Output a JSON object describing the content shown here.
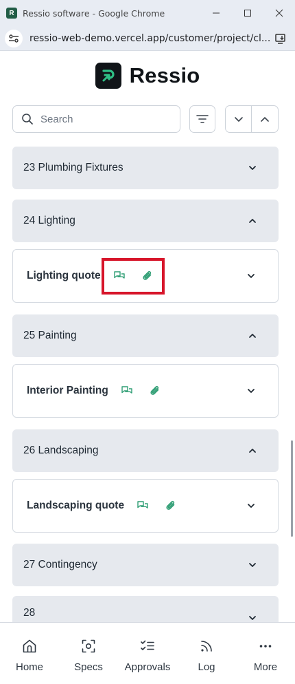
{
  "browser": {
    "window_title": "Ressio software - Google Chrome",
    "url": "ressio-web-demo.vercel.app/customer/project/cl..."
  },
  "app": {
    "brand_name": "Ressio"
  },
  "toolbar": {
    "search_placeholder": "Search"
  },
  "sections": [
    {
      "label": "23 Plumbing Fixtures",
      "expanded": false
    },
    {
      "label": "24 Lighting",
      "expanded": true,
      "items": [
        {
          "label": "Lighting quote"
        }
      ]
    },
    {
      "label": "25 Painting",
      "expanded": true,
      "items": [
        {
          "label": "Interior Painting"
        }
      ]
    },
    {
      "label": "26 Landscaping",
      "expanded": true,
      "items": [
        {
          "label": "Landscaping quote"
        }
      ]
    },
    {
      "label": "27 Contingency",
      "expanded": false
    },
    {
      "label": "28",
      "expanded": false
    }
  ],
  "bottom_nav": [
    {
      "label": "Home",
      "icon": "home-icon"
    },
    {
      "label": "Specs",
      "icon": "scan-icon"
    },
    {
      "label": "Approvals",
      "icon": "checklist-icon"
    },
    {
      "label": "Log",
      "icon": "rss-icon"
    },
    {
      "label": "More",
      "icon": "more-icon"
    }
  ],
  "colors": {
    "accent_green": "#2f9e74",
    "highlight_red": "#d7152a",
    "section_bg": "#e6e9ee"
  }
}
